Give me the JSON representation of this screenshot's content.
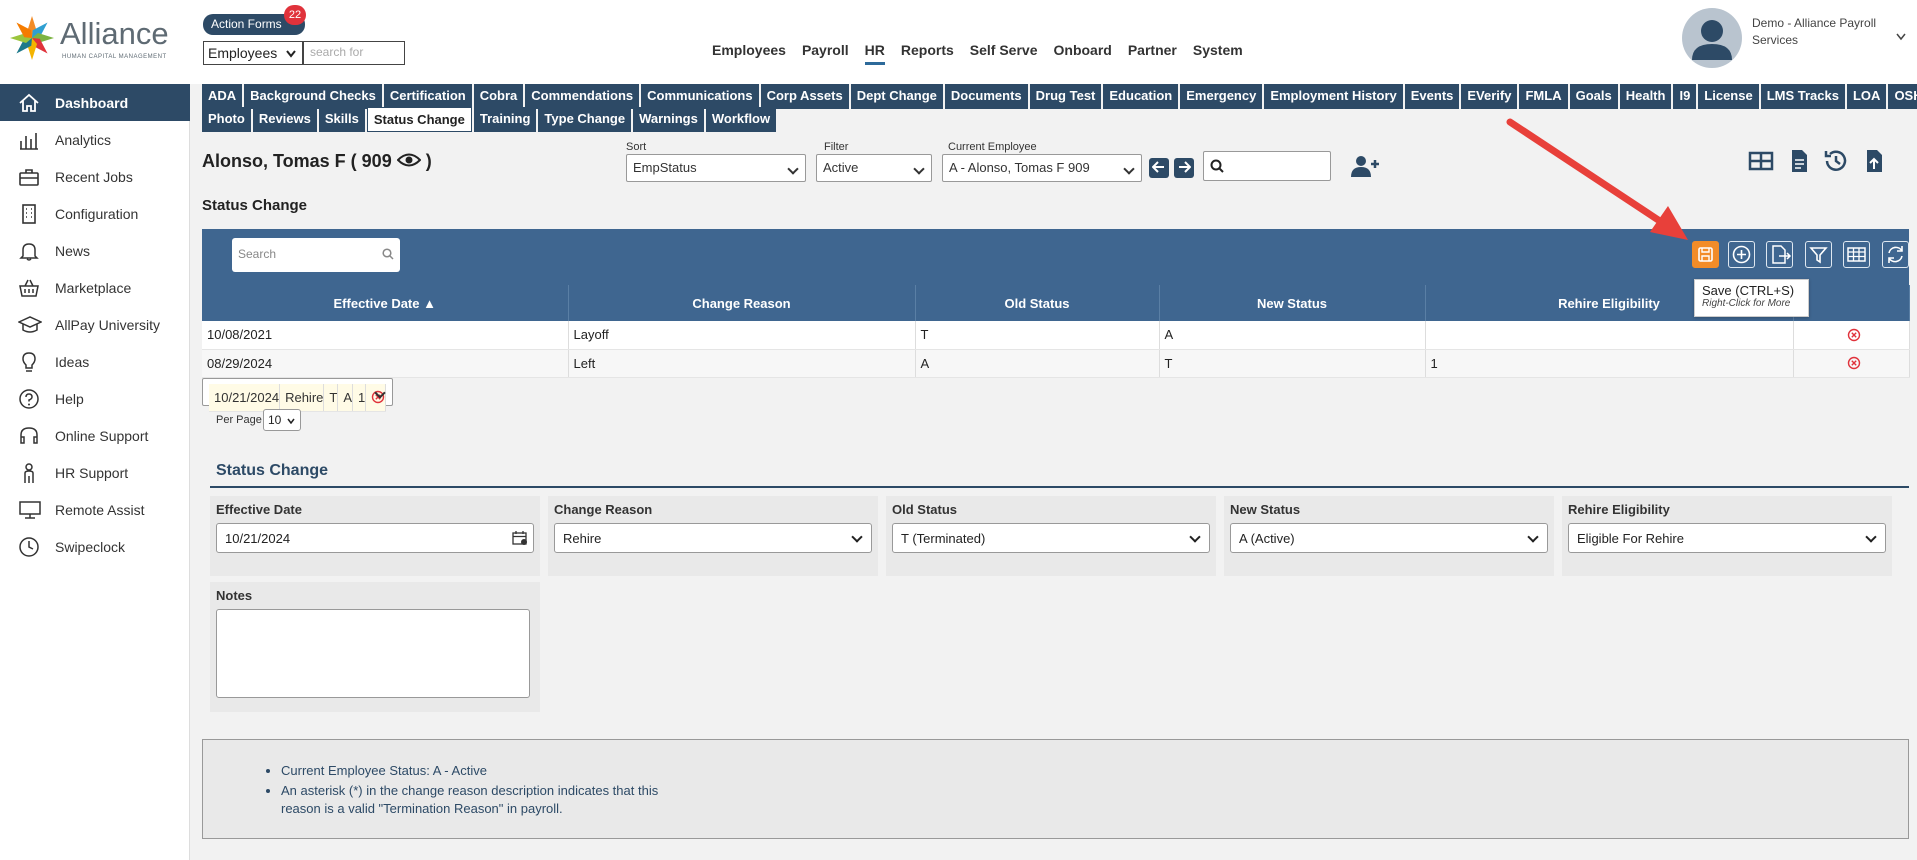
{
  "logo": {
    "name": "Alliance",
    "tagline": "HUMAN CAPITAL MANAGEMENT"
  },
  "action_forms": {
    "label": "Action Forms",
    "badge": "22"
  },
  "entity_select": {
    "value": "Employees"
  },
  "search_for": {
    "placeholder": "search for"
  },
  "main_nav": [
    "Employees",
    "Payroll",
    "HR",
    "Reports",
    "Self Serve",
    "Onboard",
    "Partner",
    "System"
  ],
  "main_nav_active": "HR",
  "user": {
    "name": "Demo - Alliance Payroll Services"
  },
  "sidebar": {
    "items": [
      {
        "label": "Dashboard",
        "icon": "home-icon",
        "active": true
      },
      {
        "label": "Analytics",
        "icon": "analytics-icon"
      },
      {
        "label": "Recent Jobs",
        "icon": "briefcase-icon"
      },
      {
        "label": "Configuration",
        "icon": "building-icon"
      },
      {
        "label": "News",
        "icon": "bell-icon"
      },
      {
        "label": "Marketplace",
        "icon": "basket-icon"
      },
      {
        "label": "AllPay University",
        "icon": "graduation-cap-icon"
      },
      {
        "label": "Ideas",
        "icon": "lightbulb-icon"
      },
      {
        "label": "Help",
        "icon": "help-icon"
      },
      {
        "label": "Online Support",
        "icon": "headset-icon"
      },
      {
        "label": "HR Support",
        "icon": "person-icon"
      },
      {
        "label": "Remote Assist",
        "icon": "monitor-icon"
      },
      {
        "label": "Swipeclock",
        "icon": "clock-icon"
      }
    ]
  },
  "tabs_row1": [
    "ADA",
    "Background Checks",
    "Certification",
    "Cobra",
    "Commendations",
    "Communications",
    "Corp Assets",
    "Dept Change",
    "Documents",
    "Drug Test",
    "Education",
    "Emergency",
    "Employment History",
    "Events",
    "EVerify",
    "FMLA",
    "Goals",
    "Health",
    "I9",
    "License",
    "LMS Tracks",
    "LOA",
    "OSHA"
  ],
  "tabs_row2": [
    "Photo",
    "Reviews",
    "Skills",
    "Status Change",
    "Training",
    "Type Change",
    "Warnings",
    "Workflow"
  ],
  "active_tab": "Status Change",
  "employee": {
    "name": "Alonso, Tomas F ( 909"
  },
  "sort": {
    "label": "Sort",
    "value": "EmpStatus"
  },
  "filter": {
    "label": "Filter",
    "value": "Active"
  },
  "current_employee": {
    "label": "Current Employee",
    "value": "A - Alonso, Tomas F 909"
  },
  "section_title": "Status Change",
  "grid": {
    "search_placeholder": "Search",
    "columns": [
      "Effective Date ▲",
      "Change Reason",
      "Old Status",
      "New Status",
      "Rehire Eligibility",
      ""
    ],
    "rows": [
      {
        "date": "10/08/2021",
        "reason": "Layoff",
        "old": "T",
        "new": "A",
        "rehire": ""
      },
      {
        "date": "08/29/2024",
        "reason": "Left",
        "old": "A",
        "new": "T",
        "rehire": "1"
      },
      {
        "date": "10/21/2024",
        "reason": "Rehire",
        "old": "T",
        "new": "A",
        "rehire": "1"
      }
    ],
    "per_page_label": "Per Page",
    "per_page": "10"
  },
  "tooltip": {
    "title": "Save (CTRL+S)",
    "hint": "Right-Click for More"
  },
  "form": {
    "title": "Status Change",
    "effective_date": {
      "label": "Effective Date",
      "value": "10/21/2024"
    },
    "change_reason": {
      "label": "Change Reason",
      "value": "Rehire"
    },
    "old_status": {
      "label": "Old Status",
      "value": "T (Terminated)"
    },
    "new_status": {
      "label": "New Status",
      "value": "A (Active)"
    },
    "rehire": {
      "label": "Rehire Eligibility",
      "value": "Eligible For Rehire"
    },
    "notes": {
      "label": "Notes",
      "value": ""
    }
  },
  "info": [
    "Current Employee Status: A - Active",
    "An asterisk (*) in the change reason description indicates that this reason is a valid \"Termination Reason\" in payroll."
  ],
  "colors": {
    "navy": "#2d4a66",
    "grid_blue": "#3f6690",
    "accent_orange": "#f28c28",
    "delete_red": "#e0323b",
    "annotation_arrow": "#e8403a"
  }
}
